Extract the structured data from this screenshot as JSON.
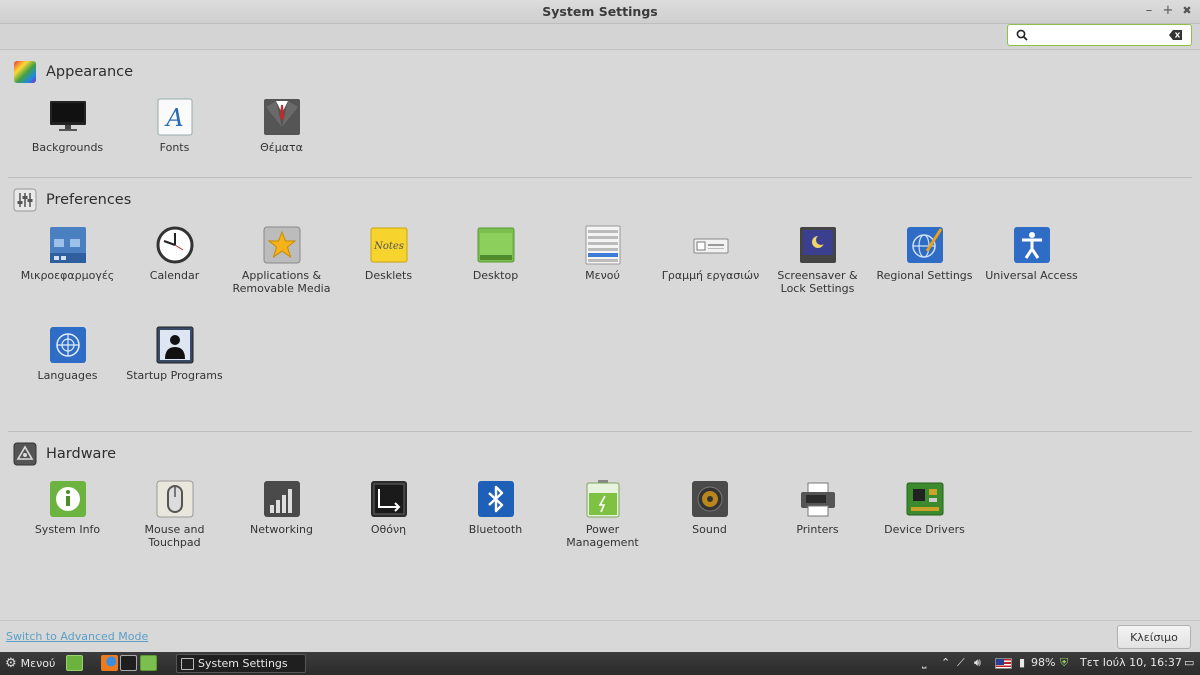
{
  "window": {
    "title": "System Settings",
    "minimize_glyph": "–",
    "maximize_glyph": "+",
    "close_glyph": "✖"
  },
  "search": {
    "value": "",
    "placeholder": ""
  },
  "sections": {
    "appearance": {
      "title": "Appearance",
      "items": [
        "Backgrounds",
        "Fonts",
        "Θέματα"
      ]
    },
    "preferences": {
      "title": "Preferences",
      "items": [
        "Μικροεφαρμογές",
        "Calendar",
        "Applications & Removable Media",
        "Desklets",
        "Desktop",
        "Μενού",
        "Γραμμή εργασιών",
        "Screensaver & Lock Settings",
        "Regional Settings",
        "Universal Access",
        "Languages",
        "Startup Programs"
      ]
    },
    "hardware": {
      "title": "Hardware",
      "items": [
        "System Info",
        "Mouse and Touchpad",
        "Networking",
        "Οθόνη",
        "Bluetooth",
        "Power Management",
        "Sound",
        "Printers",
        "Device Drivers"
      ]
    }
  },
  "footer": {
    "advanced_link": "Switch to Advanced Mode",
    "close_button": "Κλείσιμο"
  },
  "panel": {
    "menu_label": "Μενού",
    "task_label": "System Settings",
    "battery": "98%",
    "clock": "Τετ Ιούλ 10, 16:37"
  },
  "colors": {
    "accent_green": "#8fc048",
    "link_blue": "#5a9fc7",
    "panel_bg": "#2e2e2e"
  }
}
